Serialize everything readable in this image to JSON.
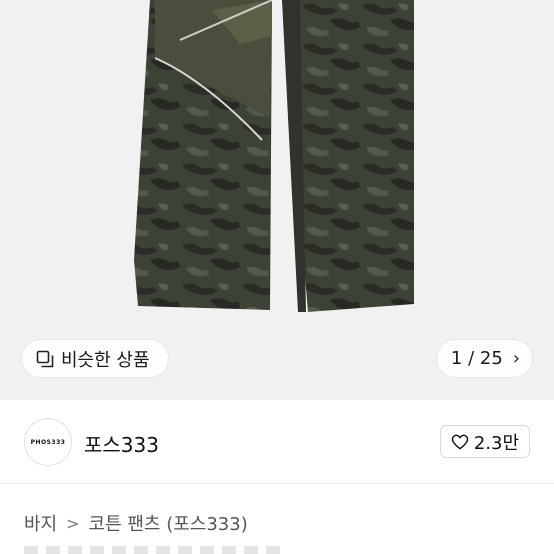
{
  "product_image": {
    "alt": "camouflage cotton pants"
  },
  "similar_button": {
    "label": "비슷한 상품",
    "icon": "similar-items-icon"
  },
  "image_counter": {
    "current": "1",
    "total": "25",
    "text": "1 / 25",
    "icon": "chevron-right-icon"
  },
  "seller": {
    "avatar_text": "PHOS333",
    "name": "포스333"
  },
  "like_button": {
    "count": "2.3만",
    "icon": "heart-icon"
  },
  "breadcrumb": {
    "items": [
      "바지",
      "코튼 팬츠 (포스333)"
    ],
    "separator": ">"
  }
}
